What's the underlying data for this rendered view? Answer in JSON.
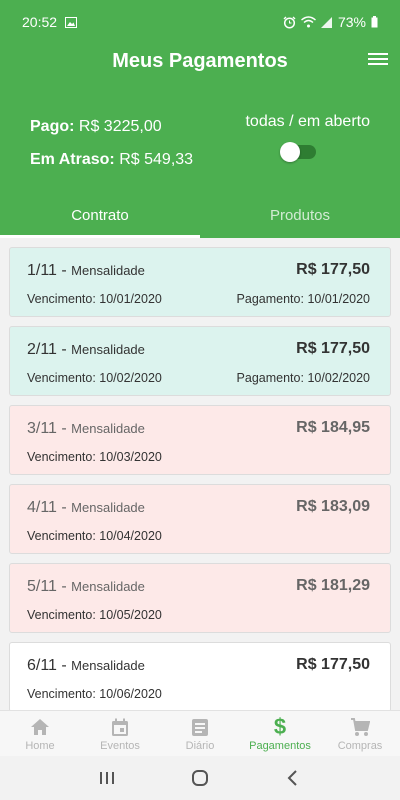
{
  "status": {
    "time": "20:52",
    "battery": "73%"
  },
  "header": {
    "title": "Meus Pagamentos"
  },
  "summary": {
    "paid_label": "Pago:",
    "paid_value": "R$ 3225,00",
    "late_label": "Em Atraso:",
    "late_value": "R$ 549,33",
    "filter_label": "todas / em aberto",
    "filter_on": false
  },
  "tabs": [
    {
      "label": "Contrato",
      "active": true
    },
    {
      "label": "Produtos",
      "active": false
    }
  ],
  "payments": [
    {
      "num": "1/11",
      "sep": " - ",
      "type": "Mensalidade",
      "value": "R$ 177,50",
      "due_label": "Vencimento:",
      "due": "10/01/2020",
      "pay_label": "Pagamento:",
      "paid": "10/01/2020",
      "status": "paid"
    },
    {
      "num": "2/11",
      "sep": " - ",
      "type": "Mensalidade",
      "value": "R$ 177,50",
      "due_label": "Vencimento:",
      "due": "10/02/2020",
      "pay_label": "Pagamento:",
      "paid": "10/02/2020",
      "status": "paid"
    },
    {
      "num": "3/11",
      "sep": " - ",
      "type": "Mensalidade",
      "value": "R$ 184,95",
      "due_label": "Vencimento:",
      "due": "10/03/2020",
      "status": "late"
    },
    {
      "num": "4/11",
      "sep": " - ",
      "type": "Mensalidade",
      "value": "R$ 183,09",
      "due_label": "Vencimento:",
      "due": "10/04/2020",
      "status": "late"
    },
    {
      "num": "5/11",
      "sep": " - ",
      "type": "Mensalidade",
      "value": "R$ 181,29",
      "due_label": "Vencimento:",
      "due": "10/05/2020",
      "status": "late"
    },
    {
      "num": "6/11",
      "sep": " - ",
      "type": "Mensalidade",
      "value": "R$ 177,50",
      "due_label": "Vencimento:",
      "due": "10/06/2020",
      "status": "open"
    }
  ],
  "bottom_nav": [
    {
      "label": "Home",
      "icon": "home-icon",
      "active": false
    },
    {
      "label": "Eventos",
      "icon": "calendar-icon",
      "active": false
    },
    {
      "label": "Diário",
      "icon": "notebook-icon",
      "active": false
    },
    {
      "label": "Pagamentos",
      "icon": "dollar-icon",
      "symbol": "$",
      "active": true
    },
    {
      "label": "Compras",
      "icon": "cart-icon",
      "active": false
    }
  ],
  "colors": {
    "primary": "#4caf50",
    "paid_card": "#dcf3ee",
    "late_card": "#fde9e8"
  }
}
